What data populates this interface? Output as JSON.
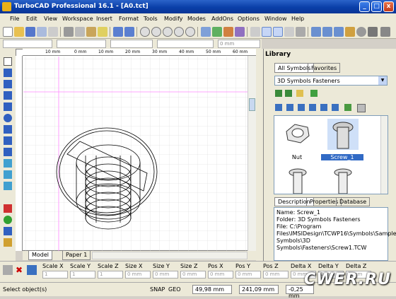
{
  "window": {
    "title": "TurboCAD Professional 16.1 - [A0.tct]",
    "min": "_",
    "max": "□",
    "close": "x"
  },
  "menu": [
    "File",
    "Edit",
    "View",
    "Workspace",
    "Insert",
    "Format",
    "Tools",
    "Modify",
    "Modes",
    "AddOns",
    "Options",
    "Window",
    "Help"
  ],
  "ruler": {
    "ticks": [
      "10 mm",
      "0 mm",
      "10 mm",
      "20 mm",
      "30 mm",
      "40 mm",
      "50 mm",
      "60 mm"
    ]
  },
  "propbar": {
    "mm": "0 mm"
  },
  "sheet_tabs": {
    "model": "Model",
    "paper": "Paper 1"
  },
  "library": {
    "title": "Library",
    "tabs": [
      "All Symbols",
      "Favorites"
    ],
    "selected_folder": "3D Symbols Fasteners",
    "symbols": [
      "Nut",
      "Screw_1"
    ],
    "bottom_tabs": [
      "Description",
      "Properties",
      "Database"
    ],
    "desc": {
      "name_label": "Name:",
      "name": "Screw_1",
      "folder_label": "Folder:",
      "folder": "3D Symbols Fasteners",
      "file_label": "File:",
      "file": "C:\\Program Files\\IMSIDesign\\TCWP16\\Symbols\\Sample Symbols\\3D Symbols\\Fasteners\\Screw1.TCW"
    }
  },
  "coords": {
    "labels": [
      "Scale X",
      "Scale Y",
      "Scale Z",
      "Size X",
      "Size Y",
      "Size Z",
      "Pos X",
      "Pos Y",
      "Pos Z",
      "Delta X",
      "Delta Y",
      "Delta Z"
    ],
    "values": [
      "1",
      "1",
      "1",
      "0 mm",
      "0 mm",
      "0 mm",
      "0 mm",
      "0 mm",
      "0 mm",
      "0 mm",
      "0 mm",
      "0 mm"
    ]
  },
  "status": {
    "text": "Select object(s)",
    "snap": "SNAP",
    "geo": "GEO",
    "x": "49,98 mm",
    "y": "241,09 mm",
    "z": "-0,25 mm"
  },
  "watermark": "CWER.RU",
  "colors": {
    "title": "#0a3fa8",
    "chrome": "#ece9d8",
    "selection": "#316ac5"
  }
}
